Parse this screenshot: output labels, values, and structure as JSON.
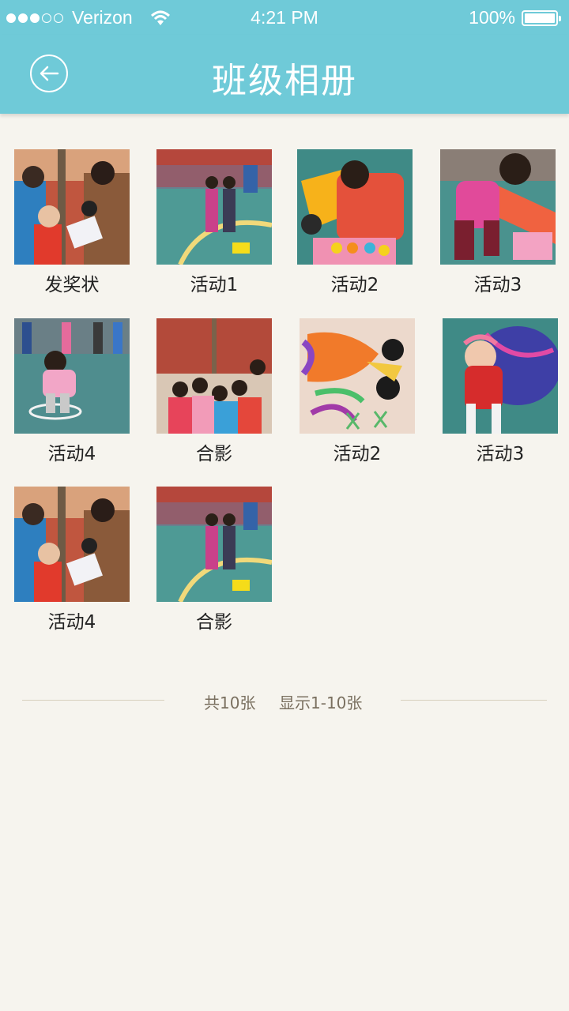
{
  "status_bar": {
    "carrier": "Verizon",
    "time": "4:21 PM",
    "battery": "100%"
  },
  "nav": {
    "title": "班级相册"
  },
  "colors": {
    "header": "#6fcad8",
    "background": "#f6f4ee"
  },
  "album": [
    {
      "caption": "发奖状",
      "photo": "award"
    },
    {
      "caption": "活动1",
      "photo": "playground"
    },
    {
      "caption": "活动2",
      "photo": "toy-car"
    },
    {
      "caption": "活动3",
      "photo": "slide"
    },
    {
      "caption": "活动4",
      "photo": "hoop"
    },
    {
      "caption": "合影",
      "photo": "group"
    },
    {
      "caption": "活动2",
      "photo": "fish-drawing"
    },
    {
      "caption": "活动3",
      "photo": "tunnel"
    },
    {
      "caption": "活动4",
      "photo": "award"
    },
    {
      "caption": "合影",
      "photo": "playground"
    }
  ],
  "footer": {
    "total": "共10张",
    "range": "显示1-10张"
  }
}
